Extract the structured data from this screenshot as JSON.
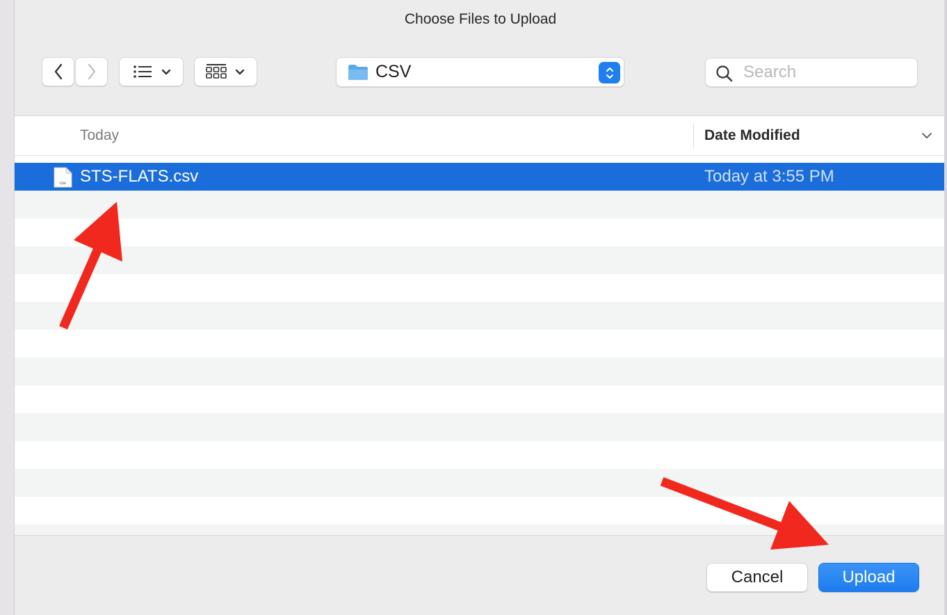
{
  "dialog": {
    "title": "Choose Files to Upload"
  },
  "toolbar": {
    "back_icon": "chevron-left-icon",
    "forward_icon": "chevron-right-icon",
    "list_view_icon": "list-view-icon",
    "grid_view_icon": "grid-view-icon",
    "location": {
      "label": "CSV",
      "icon": "folder-icon",
      "folder_color": "#5aa9e6"
    },
    "search": {
      "placeholder": "Search",
      "value": ""
    }
  },
  "list": {
    "columns": {
      "name": "Today",
      "date": "Date Modified"
    },
    "files": [
      {
        "name": "STS-FLATS.csv",
        "date": "Today at 3:55 PM",
        "icon_label": "csv",
        "selected": true
      }
    ]
  },
  "footer": {
    "cancel_label": "Cancel",
    "upload_label": "Upload"
  },
  "colors": {
    "accent": "#1a6ddb",
    "upload_button": "#1d7cf0",
    "annotation_arrow": "#f0281e"
  }
}
